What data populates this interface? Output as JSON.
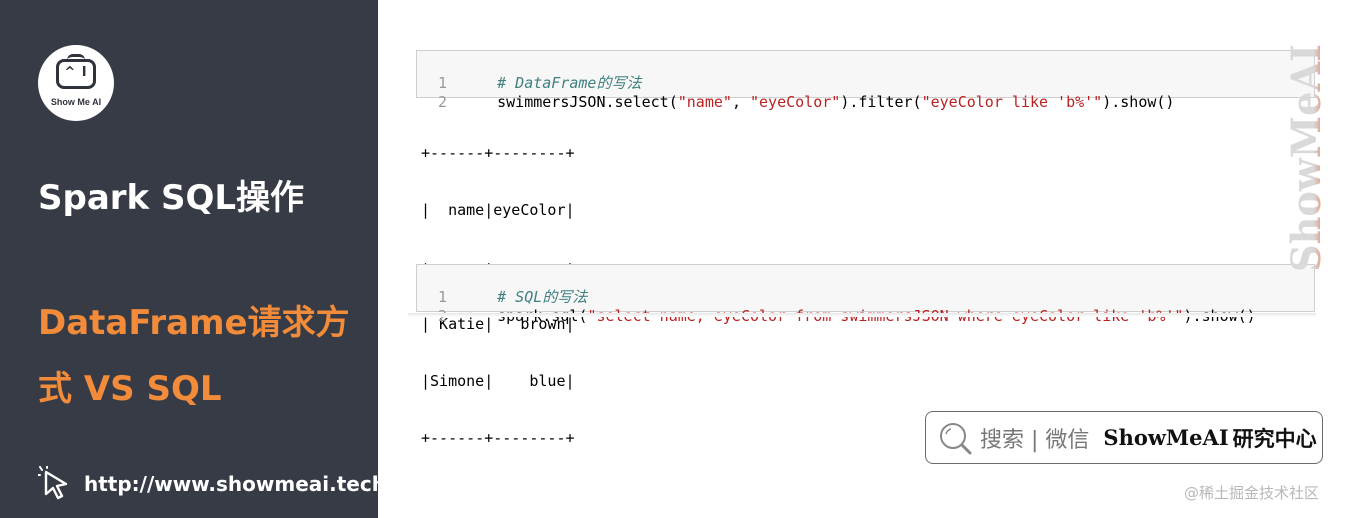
{
  "sidebar": {
    "logo_text": "Show Me AI",
    "logo_eyes": "^ I",
    "title": "Spark SQL操作",
    "subtitle": "DataFrame请求方式 VS SQL",
    "url": "http://www.showmeai.tech/",
    "colors": {
      "background": "#363b45",
      "accent": "#f28c3a"
    }
  },
  "cell1": {
    "lines": [
      {
        "num": "1",
        "comment": "# DataFrame的写法"
      },
      {
        "num": "2",
        "p1": "swimmersJSON.select(",
        "s1": "\"name\"",
        "p2": ", ",
        "s2": "\"eyeColor\"",
        "p3": ").filter(",
        "s3": "\"eyeColor like 'b%'\"",
        "p4": ").show()"
      }
    ]
  },
  "output": {
    "table_lines": [
      "+------+--------+",
      "|  name|eyeColor|",
      "+------+--------+",
      "| Katie|   brown|",
      "|Simone|    blue|",
      "+------+--------+"
    ]
  },
  "cell2": {
    "lines": [
      {
        "num": "1",
        "comment": "# SQL的写法"
      },
      {
        "num": "2",
        "p1": "spark.sql(",
        "s1": "\"select name, eyeColor from swimmersJSON where eyeColor like 'b%'\"",
        "p2": ").show()"
      }
    ]
  },
  "watermark": {
    "text": "ShowMeAI"
  },
  "search": {
    "text": "搜索 | 微信",
    "brand": "ShowMeAI",
    "brand_cn": "研究中心"
  },
  "credit": "@稀土掘金技术社区",
  "icons": {
    "logo": "robot-face-logo-icon",
    "link": "cursor-click-icon",
    "search": "magnifier-icon"
  }
}
